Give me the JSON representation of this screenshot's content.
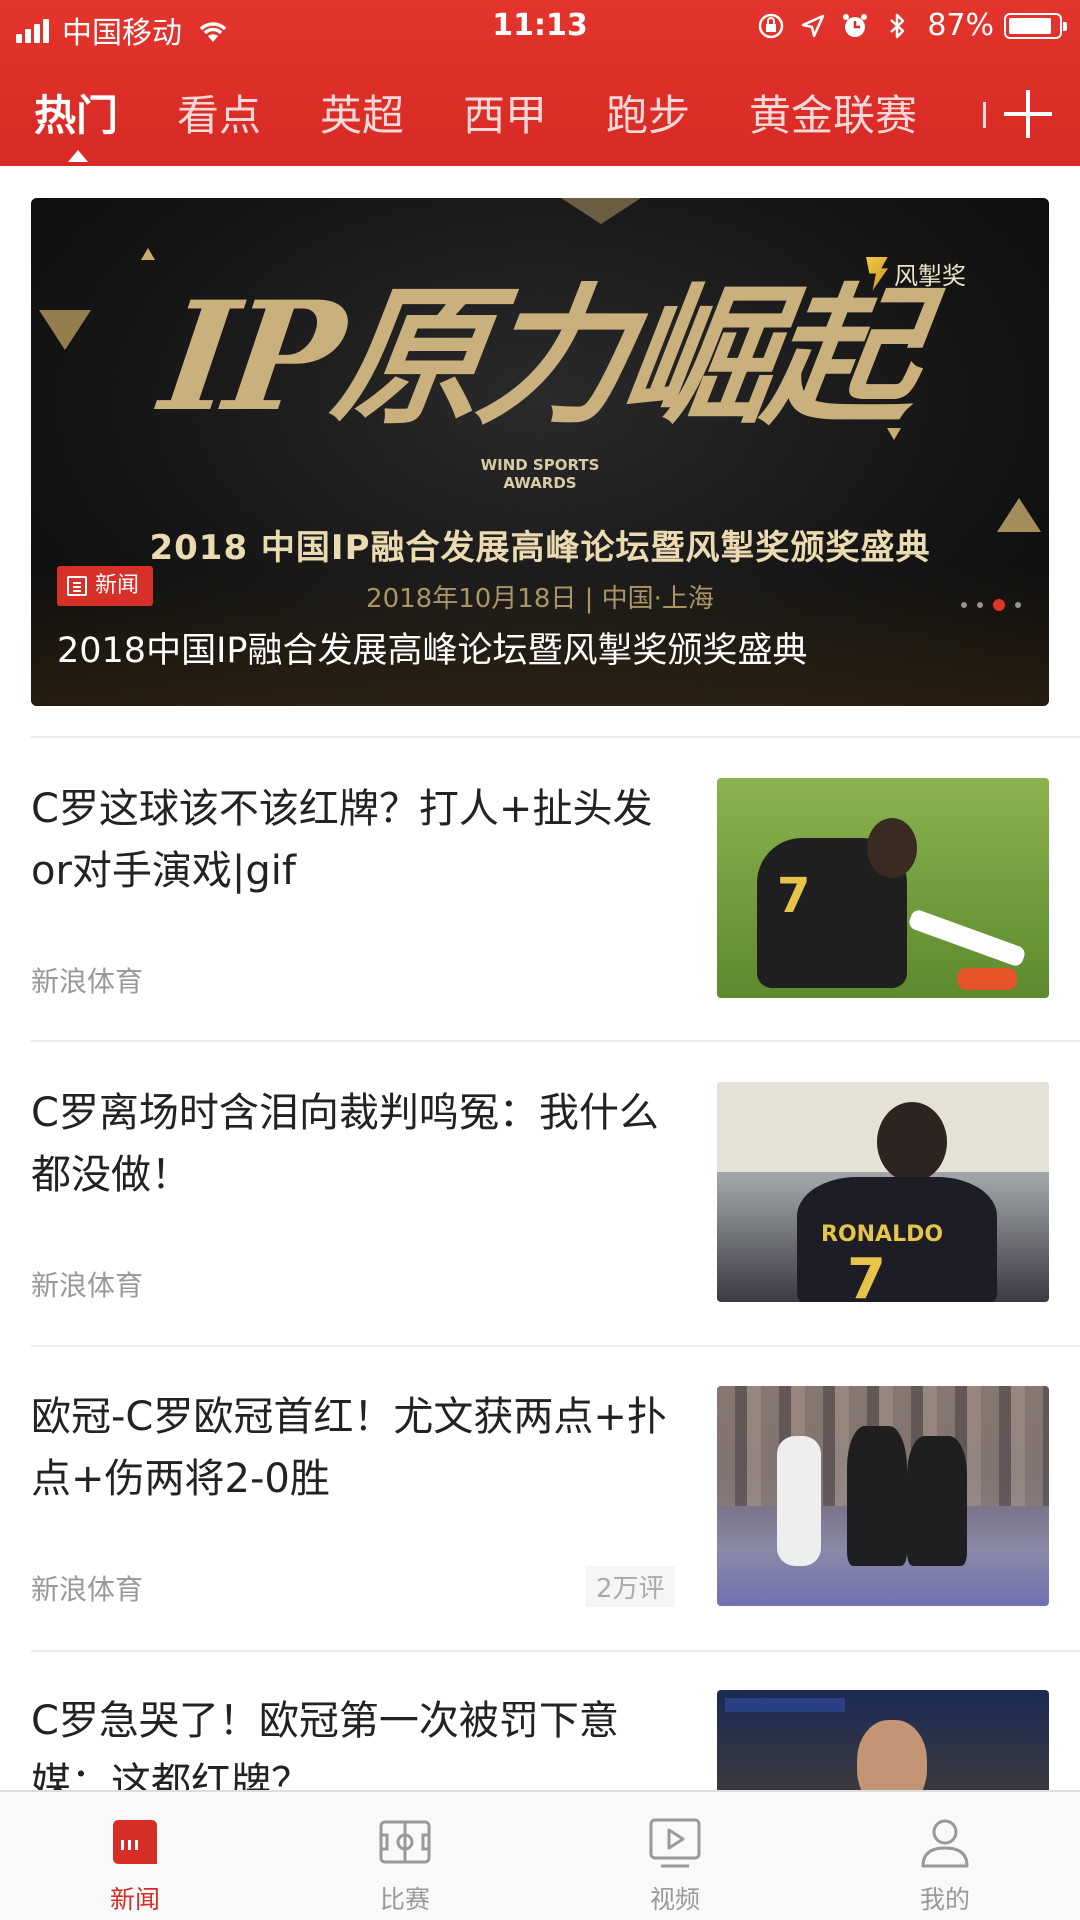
{
  "status_bar": {
    "carrier": "中国移动",
    "time": "11:13",
    "battery_pct": "87%",
    "battery_level": 0.87
  },
  "top_tabs": [
    {
      "label": "热门",
      "active": true
    },
    {
      "label": "看点",
      "active": false
    },
    {
      "label": "英超",
      "active": false
    },
    {
      "label": "西甲",
      "active": false
    },
    {
      "label": "跑步",
      "active": false
    },
    {
      "label": "黄金联赛",
      "active": false
    }
  ],
  "banner": {
    "calligraphy": "IP原力崛起",
    "wind_line1": "WIND SPORTS",
    "wind_line2": "AWARDS",
    "brand": "风掣奖",
    "event_title": "2018 中国IP融合发展高峰论坛暨风掣奖颁奖盛典",
    "event_sub": "2018年10月18日 | 中国·上海",
    "badge": "新闻",
    "caption": "2018中国IP融合发展高峰论坛暨风掣奖颁奖盛典",
    "page_count": 4,
    "active_page": 3
  },
  "news": [
    {
      "title": "C罗这球该不该红牌？打人+扯头发or对手演戏|gif",
      "source": "新浪体育",
      "comments": ""
    },
    {
      "title": "C罗离场时含泪向裁判鸣冤：我什么都没做！",
      "source": "新浪体育",
      "comments": ""
    },
    {
      "title": "欧冠-C罗欧冠首红！尤文获两点+扑点+伤两将2-0胜",
      "source": "新浪体育",
      "comments": "2万评"
    },
    {
      "title": "C罗急哭了！欧冠第一次被罚下意媒：这都红牌？",
      "source": "",
      "comments": ""
    }
  ],
  "thumb_labels": {
    "jersey_name": "RONALDO",
    "jersey_number": "7"
  },
  "bottom_tabs": [
    {
      "label": "新闻",
      "icon": "newspaper-icon",
      "active": true
    },
    {
      "label": "比赛",
      "icon": "football-pitch-icon",
      "active": false
    },
    {
      "label": "视频",
      "icon": "play-video-icon",
      "active": false
    },
    {
      "label": "我的",
      "icon": "user-profile-icon",
      "active": false
    }
  ],
  "colors": {
    "brand_red": "#d82a24",
    "active_tab_red": "#d62e27"
  }
}
